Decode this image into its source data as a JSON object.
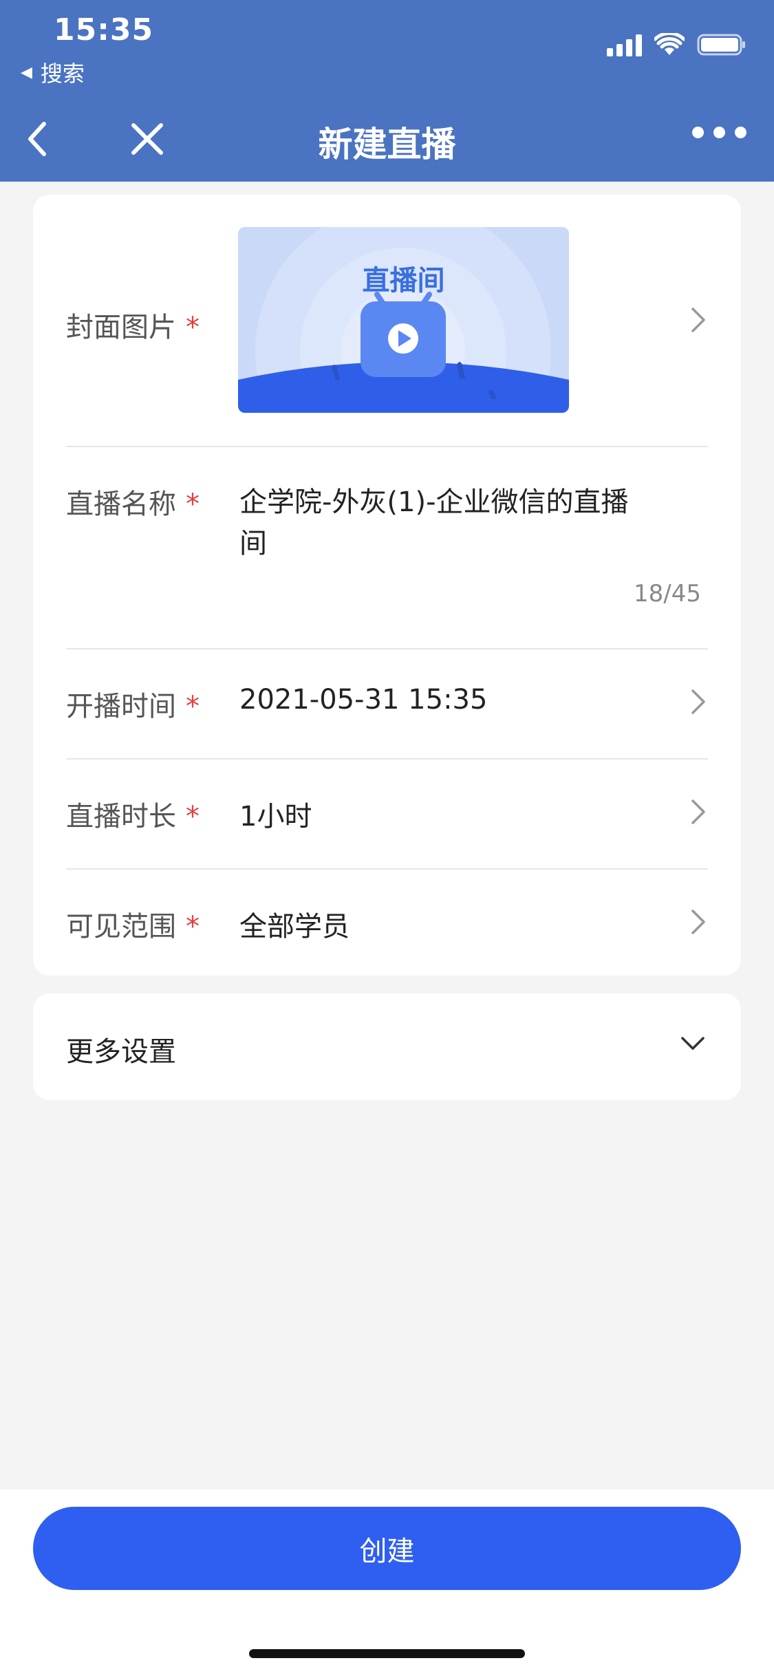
{
  "status_bar": {
    "time": "15:35",
    "back_app": "搜索"
  },
  "nav": {
    "title": "新建直播"
  },
  "form": {
    "cover": {
      "label": "封面图片",
      "required_mark": "*",
      "image_text": "直播间"
    },
    "name": {
      "label": "直播名称",
      "required_mark": "*",
      "value": "企学院-外灰(1)-企业微信的直播间",
      "counter": "18/45"
    },
    "start_time": {
      "label": "开播时间",
      "required_mark": "*",
      "value": "2021-05-31 15:35"
    },
    "duration": {
      "label": "直播时长",
      "required_mark": "*",
      "value": "1小时"
    },
    "visibility": {
      "label": "可见范围",
      "required_mark": "*",
      "value": "全部学员"
    }
  },
  "more_settings": {
    "label": "更多设置"
  },
  "create_button": {
    "label": "创建"
  },
  "colors": {
    "header": "#4a73c2",
    "primary": "#2f5ff0",
    "required": "#e04040",
    "background": "#f4f4f5"
  }
}
